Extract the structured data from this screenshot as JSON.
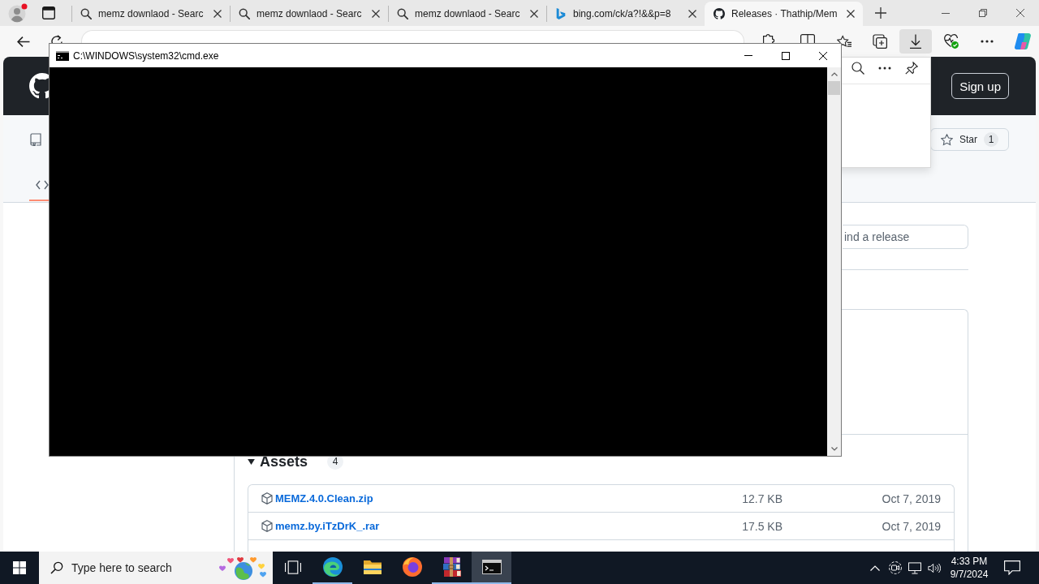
{
  "browser": {
    "tabs": [
      {
        "kind": "search",
        "title": "memz downlaod - Searc",
        "selected": false
      },
      {
        "kind": "search",
        "title": "memz downlaod - Searc",
        "selected": false
      },
      {
        "kind": "search",
        "title": "memz downlaod - Searc",
        "selected": false
      },
      {
        "kind": "bing",
        "title": "bing.com/ck/a?!&&p=8",
        "selected": false
      },
      {
        "kind": "github",
        "title": "Releases · Thathip/Mem",
        "selected": true
      }
    ],
    "toolbar_buttons": [
      {
        "kind": "favorites",
        "selected": false
      },
      {
        "kind": "collections",
        "selected": false
      },
      {
        "kind": "downloads",
        "selected": true
      },
      {
        "kind": "health",
        "selected": false
      },
      {
        "kind": "more",
        "selected": false
      },
      {
        "kind": "copilot",
        "selected": false
      }
    ]
  },
  "console_window": {
    "title": "C:\\WINDOWS\\system32\\cmd.exe"
  },
  "github": {
    "sign_up": "Sign up",
    "nav_tabs": [
      {
        "kind": "code",
        "selected": true
      }
    ],
    "star": {
      "label": "Star",
      "count": "1"
    },
    "release_search": {
      "placeholder": "ind a release"
    },
    "assets": {
      "title": "Assets",
      "count": "4",
      "expanded": true,
      "files": [
        {
          "name": "MEMZ.4.0.Clean.zip",
          "size": "12.7 KB",
          "date": "Oct 7, 2019"
        },
        {
          "name": "memz.by.iTzDrK_.rar",
          "size": "17.5 KB",
          "date": "Oct 7, 2019"
        }
      ]
    }
  },
  "taskbar": {
    "search": {
      "placeholder": "Type here to search"
    },
    "apps": [
      {
        "kind": "task_view",
        "selected": false,
        "running": false
      },
      {
        "kind": "edge",
        "selected": false,
        "running": true
      },
      {
        "kind": "explorer",
        "selected": false,
        "running": false
      },
      {
        "kind": "firefox",
        "selected": false,
        "running": false
      },
      {
        "kind": "winrar",
        "selected": false,
        "running": true
      },
      {
        "kind": "cmd",
        "selected": true,
        "running": true
      }
    ],
    "time": "4:33 PM",
    "date": "9/7/2024"
  }
}
